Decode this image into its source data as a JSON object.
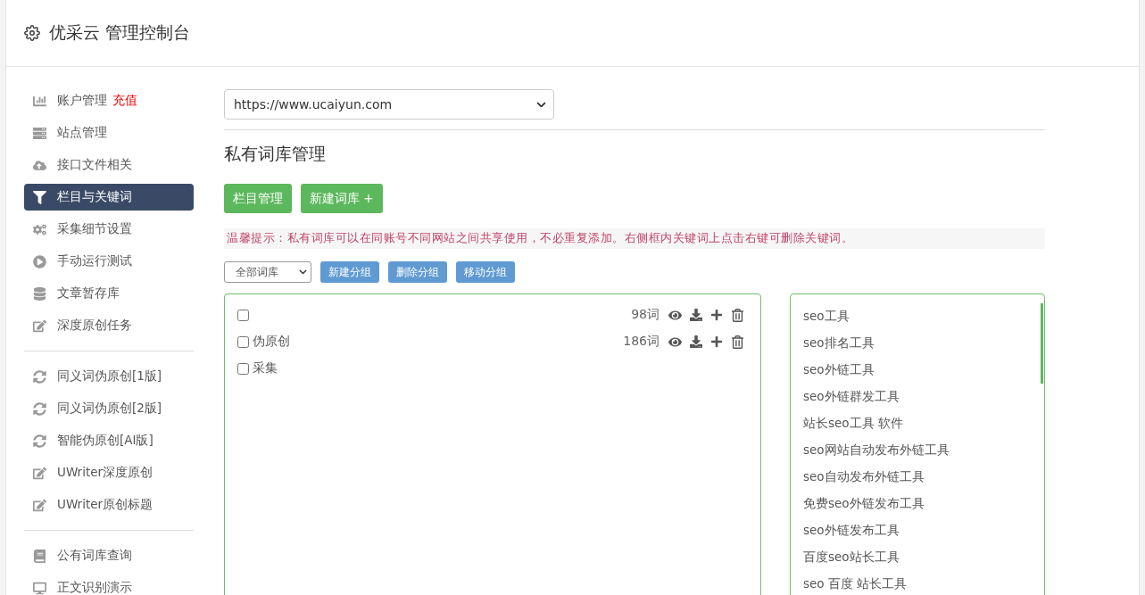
{
  "header": {
    "title": "优采云 管理控制台"
  },
  "sidebar": {
    "sections": [
      [
        {
          "label": "账户管理",
          "badge": "充值",
          "selected": false
        },
        {
          "label": "站点管理",
          "selected": false
        },
        {
          "label": "接口文件相关",
          "selected": false
        },
        {
          "label": "栏目与关键词",
          "selected": true
        },
        {
          "label": "采集细节设置",
          "selected": false
        },
        {
          "label": "手动运行测试",
          "selected": false
        },
        {
          "label": "文章暂存库",
          "selected": false
        },
        {
          "label": "深度原创任务",
          "selected": false
        }
      ],
      [
        {
          "label": "同义词伪原创[1版]",
          "selected": false
        },
        {
          "label": "同义词伪原创[2版]",
          "selected": false
        },
        {
          "label": "智能伪原创[AI版]",
          "selected": false
        },
        {
          "label": "UWriter深度原创",
          "selected": false
        },
        {
          "label": "UWriter原创标题",
          "selected": false
        }
      ],
      [
        {
          "label": "公有词库查询",
          "selected": false
        },
        {
          "label": "正文识别演示",
          "selected": false
        }
      ]
    ]
  },
  "main": {
    "site_select": "https://www.ucaiyun.com",
    "heading": "私有词库管理",
    "buttons": [
      "栏目管理",
      "新建词库 +"
    ],
    "notice": "温馨提示：私有词库可以在同账号不同网站之间共享使用，不必重复添加。右侧框内关键词上点击右键可删除关键词。",
    "filter_select": "全部词库",
    "group_buttons": [
      "新建分组",
      "删除分组",
      "移动分组"
    ],
    "groups": [
      {
        "count": "98词",
        "checked": false
      },
      {
        "name": "伪原创",
        "count": "186词",
        "checked": false
      },
      {
        "name": "采集",
        "checked": false
      }
    ],
    "keywords": [
      "seo工具",
      "seo排名工具",
      "seo外链工具",
      "seo外链群发工具",
      "站长seo工具 软件",
      "seo网站自动发布外链工具",
      "seo自动发布外链工具",
      "免费seo外链发布工具",
      "seo外链发布工具",
      "百度seo站长工具",
      "seo 百度 站长工具"
    ]
  }
}
